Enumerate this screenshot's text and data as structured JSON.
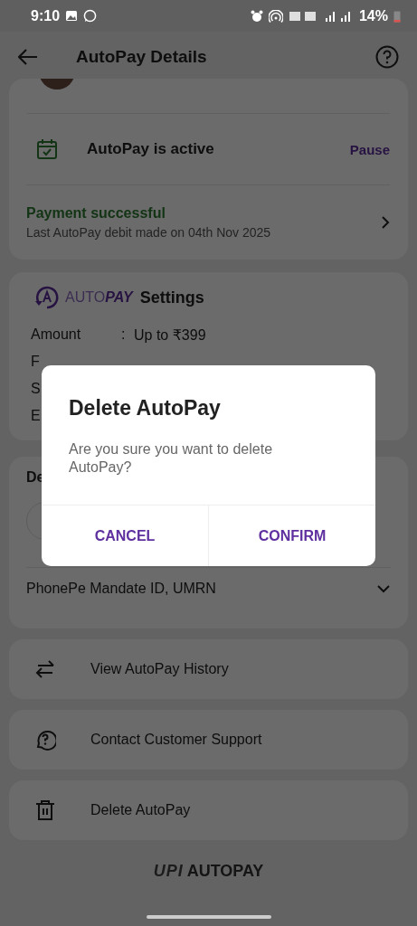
{
  "status_bar": {
    "time": "9:10",
    "battery": "14%"
  },
  "header": {
    "title": "AutoPay Details"
  },
  "status_card": {
    "status": "AutoPay is active",
    "action": "Pause",
    "payment_title": "Payment successful",
    "payment_detail": "Last AutoPay debit made on 04th Nov 2025"
  },
  "settings": {
    "logo_text_1": "AUTO",
    "logo_text_2": "PAY",
    "title": "Settings",
    "rows": [
      {
        "label": "Amount",
        "separator": ":",
        "value": "Up to ₹399"
      },
      {
        "label": "F"
      },
      {
        "label": "S"
      },
      {
        "label": "E"
      }
    ]
  },
  "details": {
    "heading": "De",
    "mandate": "PhonePe Mandate ID, UMRN",
    "expanded": false
  },
  "actions": [
    {
      "kind": "history",
      "label": "View AutoPay History"
    },
    {
      "kind": "support",
      "label": "Contact Customer Support"
    },
    {
      "kind": "delete",
      "label": "Delete AutoPay"
    }
  ],
  "footer": {
    "logo_mark": "UPI",
    "logo_text": "AUTOPAY"
  },
  "dialog": {
    "title": "Delete AutoPay",
    "message": "Are you sure you want to delete AutoPay?",
    "buttons": [
      "CANCEL",
      "CONFIRM"
    ]
  }
}
